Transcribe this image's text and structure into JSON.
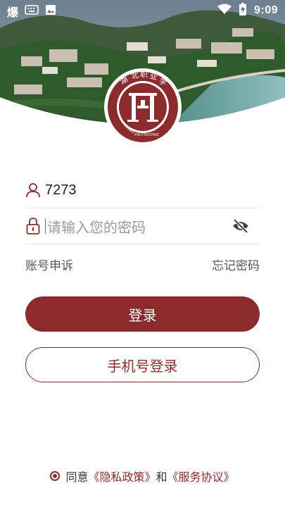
{
  "status_bar": {
    "app_badge": "爆",
    "time": "9:09"
  },
  "colors": {
    "brand": "#8b2b2c",
    "divider": "#e6e6e6"
  },
  "logo": {
    "name": "湖北职业技术学院",
    "text": "HUBEI POLYTECHNIC UNIVERSITY"
  },
  "login": {
    "username_value": "7273",
    "password_placeholder": "请输入您的密码",
    "appeal_link": "账号申诉",
    "forgot_link": "忘记密码",
    "login_button": "登录",
    "phone_login_button": "手机号登录"
  },
  "agreement": {
    "prefix": "同意",
    "privacy": "《隐私政策》",
    "and": "和",
    "service": "《服务协议》",
    "checked": true
  }
}
